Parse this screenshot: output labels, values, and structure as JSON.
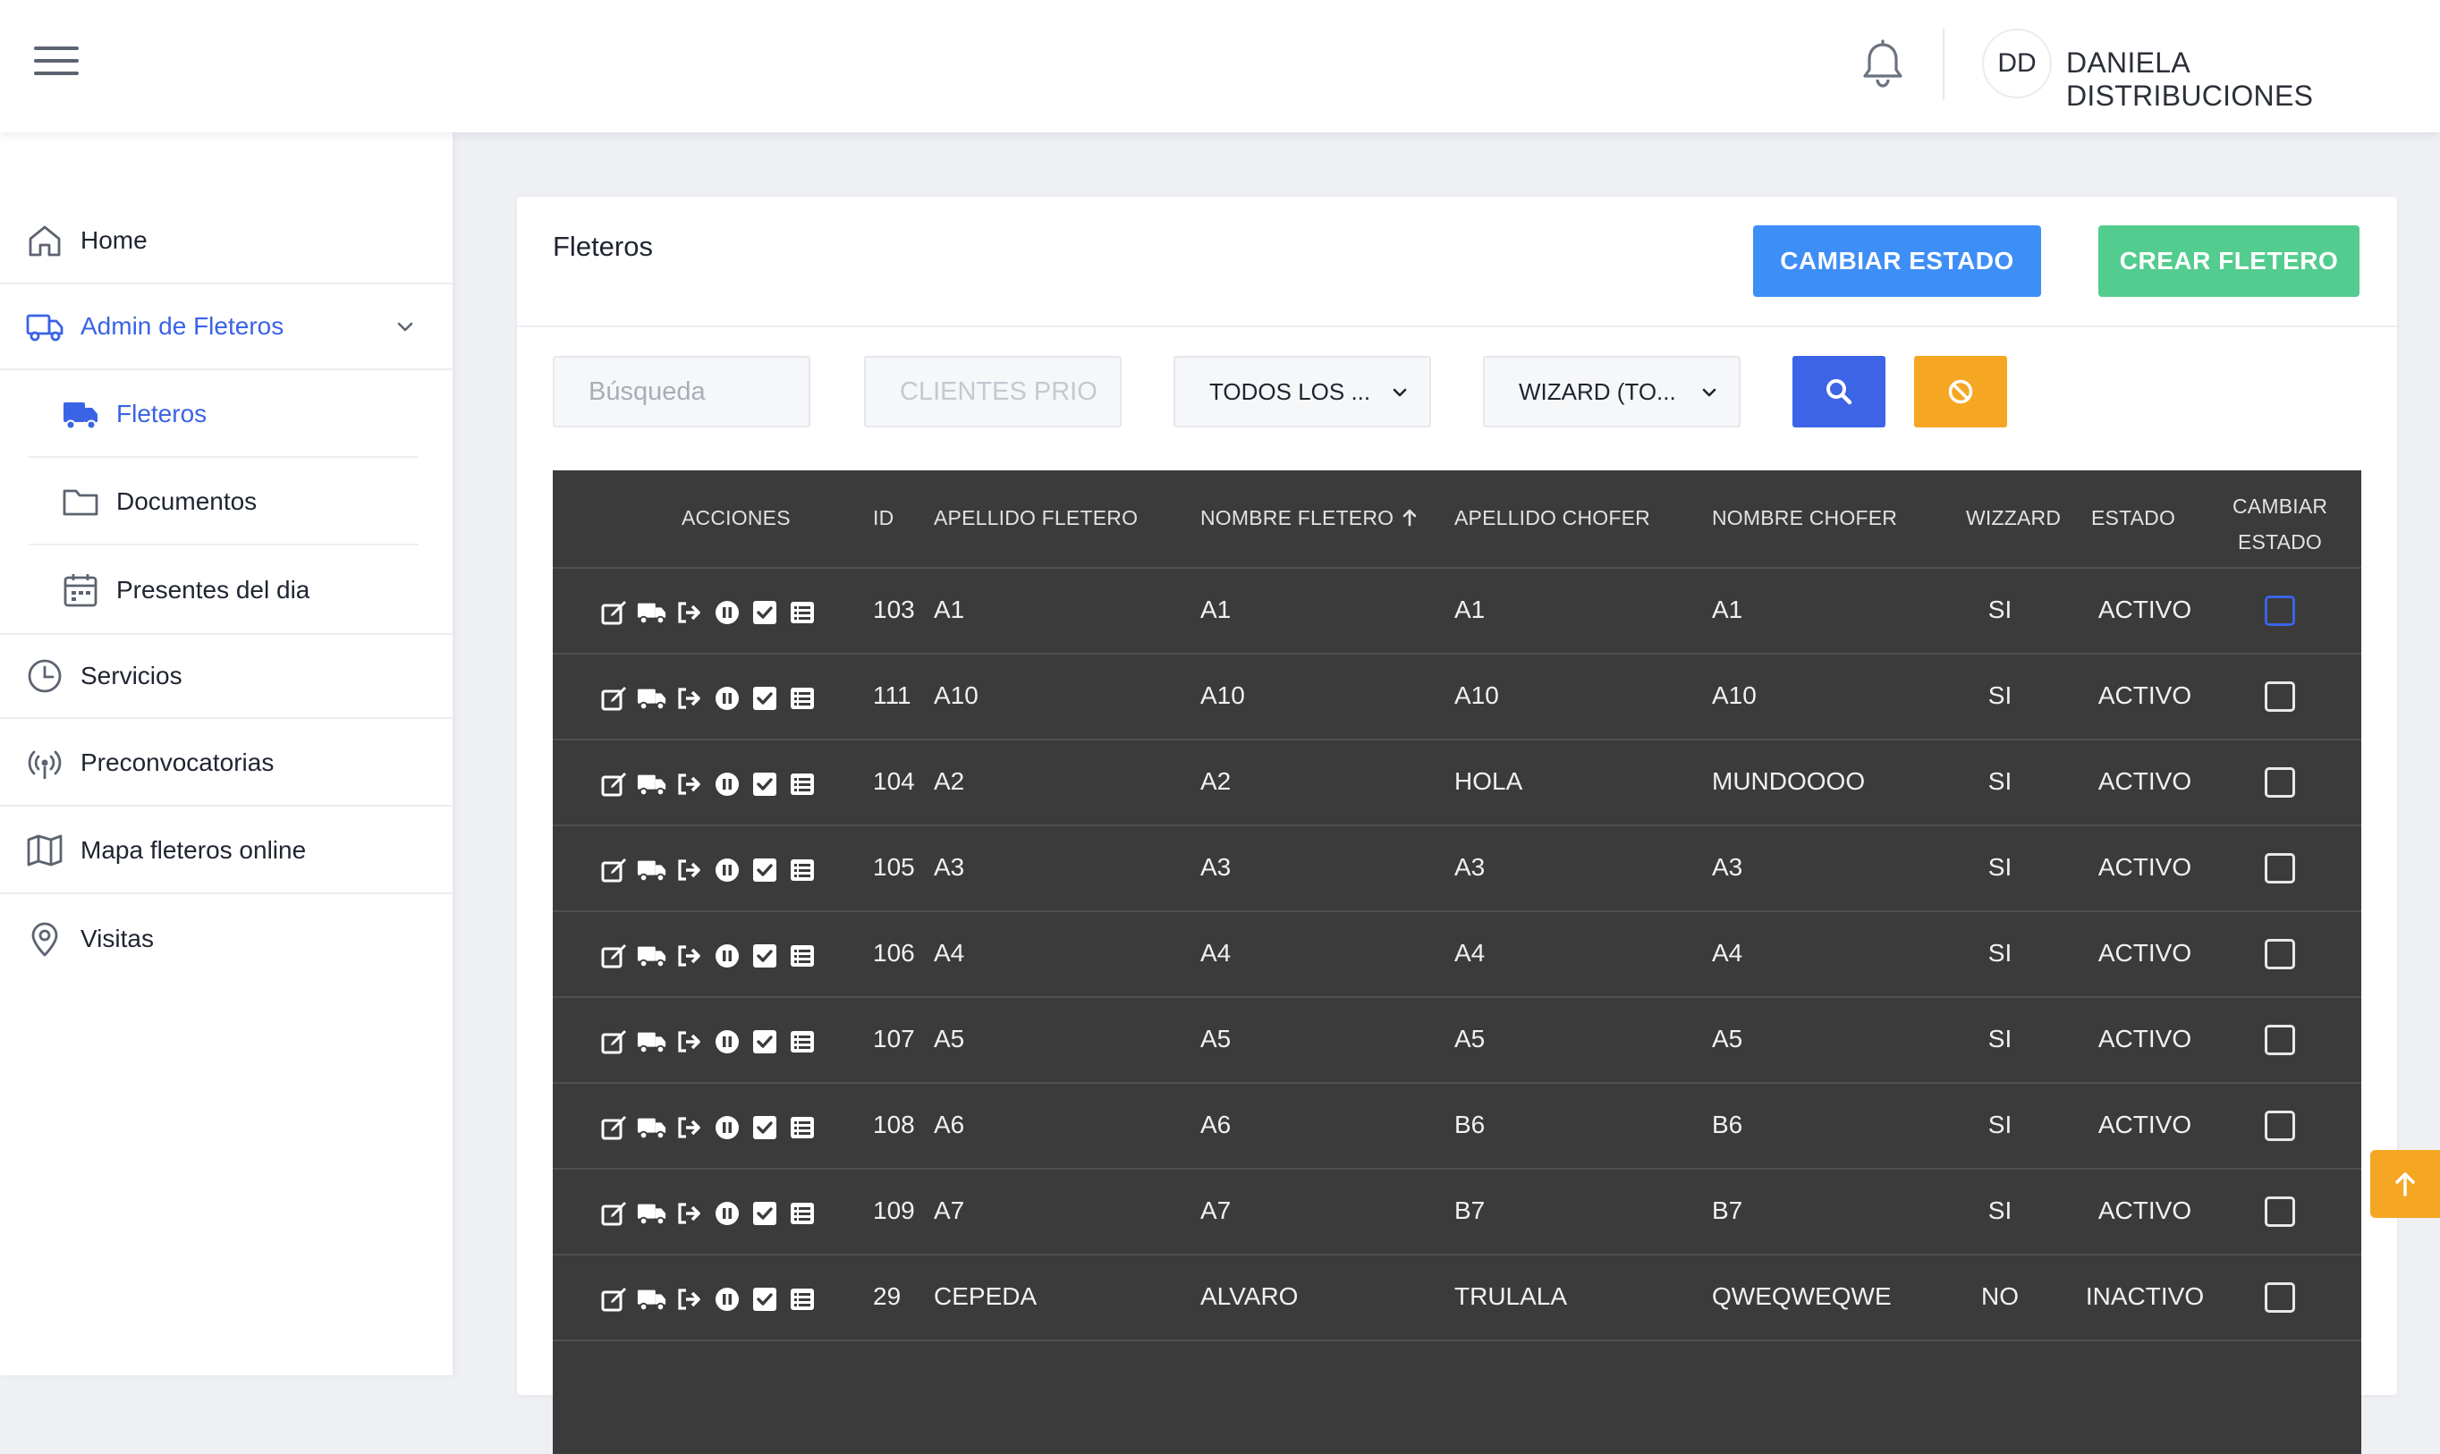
{
  "header": {
    "avatar_initials": "DD",
    "user_name": "DANIELA DISTRIBUCIONES"
  },
  "sidebar": {
    "items": [
      {
        "label": "Home",
        "icon": "home-icon"
      },
      {
        "label": "Admin de Fleteros",
        "icon": "truck-icon",
        "active": true,
        "expanded": true
      },
      {
        "label": "Servicios",
        "icon": "clock-icon"
      },
      {
        "label": "Preconvocatorias",
        "icon": "broadcast-icon"
      },
      {
        "label": "Mapa fleteros online",
        "icon": "map-icon"
      },
      {
        "label": "Visitas",
        "icon": "location-pin-icon"
      }
    ],
    "subitems": [
      {
        "label": "Fleteros",
        "icon": "truck-solid-icon",
        "active": true
      },
      {
        "label": "Documentos",
        "icon": "folder-icon"
      },
      {
        "label": "Presentes del dia",
        "icon": "calendar-icon"
      }
    ]
  },
  "card": {
    "title": "Fleteros",
    "change_state_button": "CAMBIAR ESTADO",
    "create_button": "CREAR FLETERO"
  },
  "filters": {
    "search_placeholder": "Búsqueda",
    "clients_placeholder": "CLIENTES PRIO",
    "select_all": "TODOS LOS ...",
    "select_wizard": "WIZARD (TO..."
  },
  "table": {
    "headers": {
      "acciones": "ACCIONES",
      "id": "ID",
      "apellido_fletero": "APELLIDO FLETERO",
      "nombre_fletero": "NOMBRE FLETERO",
      "apellido_chofer": "APELLIDO CHOFER",
      "nombre_chofer": "NOMBRE CHOFER",
      "wizzard": "WIZZARD",
      "estado": "ESTADO",
      "cambiar_estado_line1": "CAMBIAR",
      "cambiar_estado_line2": "ESTADO"
    },
    "sorted_by": "NOMBRE FLETERO",
    "sort_direction": "ascending",
    "action_icons": [
      "edit-icon",
      "truck-icon",
      "logout-icon",
      "pause-icon",
      "check-square-icon",
      "list-icon"
    ],
    "rows": [
      {
        "id": "103",
        "apellido_fletero": "A1",
        "nombre_fletero": "A1",
        "apellido_chofer": "A1",
        "nombre_chofer": "A1",
        "wizzard": "SI",
        "estado": "ACTIVO",
        "focused": true
      },
      {
        "id": "111",
        "apellido_fletero": "A10",
        "nombre_fletero": "A10",
        "apellido_chofer": "A10",
        "nombre_chofer": "A10",
        "wizzard": "SI",
        "estado": "ACTIVO"
      },
      {
        "id": "104",
        "apellido_fletero": "A2",
        "nombre_fletero": "A2",
        "apellido_chofer": "HOLA",
        "nombre_chofer": "MUNDOOOO",
        "wizzard": "SI",
        "estado": "ACTIVO"
      },
      {
        "id": "105",
        "apellido_fletero": "A3",
        "nombre_fletero": "A3",
        "apellido_chofer": "A3",
        "nombre_chofer": "A3",
        "wizzard": "SI",
        "estado": "ACTIVO"
      },
      {
        "id": "106",
        "apellido_fletero": "A4",
        "nombre_fletero": "A4",
        "apellido_chofer": "A4",
        "nombre_chofer": "A4",
        "wizzard": "SI",
        "estado": "ACTIVO"
      },
      {
        "id": "107",
        "apellido_fletero": "A5",
        "nombre_fletero": "A5",
        "apellido_chofer": "A5",
        "nombre_chofer": "A5",
        "wizzard": "SI",
        "estado": "ACTIVO"
      },
      {
        "id": "108",
        "apellido_fletero": "A6",
        "nombre_fletero": "A6",
        "apellido_chofer": "B6",
        "nombre_chofer": "B6",
        "wizzard": "SI",
        "estado": "ACTIVO"
      },
      {
        "id": "109",
        "apellido_fletero": "A7",
        "nombre_fletero": "A7",
        "apellido_chofer": "B7",
        "nombre_chofer": "B7",
        "wizzard": "SI",
        "estado": "ACTIVO"
      },
      {
        "id": "29",
        "apellido_fletero": "CEPEDA",
        "nombre_fletero": "ALVARO",
        "apellido_chofer": "TRULALA",
        "nombre_chofer": "QWEQWEQWE",
        "wizzard": "NO",
        "estado": "INACTIVO"
      }
    ]
  },
  "colors": {
    "accent_blue": "#3e8ef7",
    "accent_green": "#53cc8f",
    "search_button": "#3d63e6",
    "clear_button": "#f5a623",
    "table_bg": "#3b3b3b",
    "active_nav": "#3a63e6"
  }
}
